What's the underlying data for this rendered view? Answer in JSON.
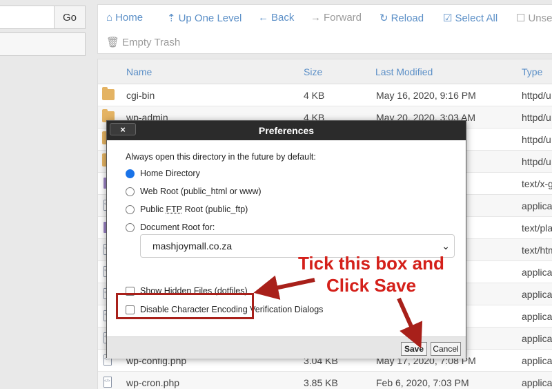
{
  "left": {
    "go_label": "Go"
  },
  "toolbar": {
    "home": "Home",
    "up_one_level": "Up One Level",
    "back": "Back",
    "forward": "Forward",
    "reload": "Reload",
    "select_all": "Select All",
    "unselect_partial": "Unse",
    "empty_trash": "Empty Trash"
  },
  "table": {
    "headers": {
      "name": "Name",
      "size": "Size",
      "last_modified": "Last Modified",
      "type": "Type"
    },
    "rows": [
      {
        "name": "cgi-bin",
        "size": "4 KB",
        "modified": "May 16, 2020, 9:16 PM",
        "type": "httpd/u",
        "icon": "folder-icon"
      },
      {
        "name": "wp-admin",
        "size": "4 KB",
        "modified": "May 20, 2020, 3:03 AM",
        "type": "httpd/u",
        "icon": "folder-icon"
      },
      {
        "name": "",
        "size": "",
        "modified": "M",
        "type": "httpd/u",
        "icon": "folder-icon"
      },
      {
        "name": "",
        "size": "",
        "modified": "M",
        "type": "httpd/u",
        "icon": "folder-icon"
      },
      {
        "name": "",
        "size": "",
        "modified": "PM",
        "type": "text/x-g",
        "icon": "text-file-icon"
      },
      {
        "name": "",
        "size": "",
        "modified": "M",
        "type": "applica",
        "icon": "code-file-icon"
      },
      {
        "name": "",
        "size": "",
        "modified": "AM",
        "type": "text/pla",
        "icon": "text-file-icon"
      },
      {
        "name": "",
        "size": "",
        "modified": "PM",
        "type": "text/htm",
        "icon": "code-file-icon"
      },
      {
        "name": "",
        "size": "",
        "modified": "M",
        "type": "applica",
        "icon": "code-file-icon"
      },
      {
        "name": "",
        "size": "",
        "modified": "M",
        "type": "applica",
        "icon": "code-file-icon"
      },
      {
        "name": "",
        "size": "",
        "modified": "PM",
        "type": "applica",
        "icon": "code-file-icon"
      },
      {
        "name": "",
        "size": "",
        "modified": "M",
        "type": "applica",
        "icon": "code-file-icon"
      },
      {
        "name": "wp-config.php",
        "size": "3.04 KB",
        "modified": "May 17, 2020, 7:08 PM",
        "type": "applica",
        "icon": "code-file-icon"
      },
      {
        "name": "wp-cron.php",
        "size": "3.85 KB",
        "modified": "Feb 6, 2020, 7:03 PM",
        "type": "applica",
        "icon": "code-file-icon"
      }
    ]
  },
  "modal": {
    "title": "Preferences",
    "close_label": "×",
    "intro": "Always open this directory in the future by default:",
    "options": {
      "home": "Home Directory",
      "web_root": "Web Root (public_html or www)",
      "ftp_prefix": "Public ",
      "ftp_abbr": "FTP",
      "ftp_suffix": " Root (public_ftp)",
      "doc_root": "Document Root for:"
    },
    "domain_select_value": "mashjoymall.co.za",
    "show_hidden": "Show Hidden Files (dotfiles)",
    "disable_encoding": "Disable Character Encoding Verification Dialogs",
    "save_label": "Save",
    "cancel_label": "Cancel"
  },
  "annotation": {
    "line1": "Tick this box and",
    "line2": "Click Save",
    "color": "#d4201a"
  }
}
